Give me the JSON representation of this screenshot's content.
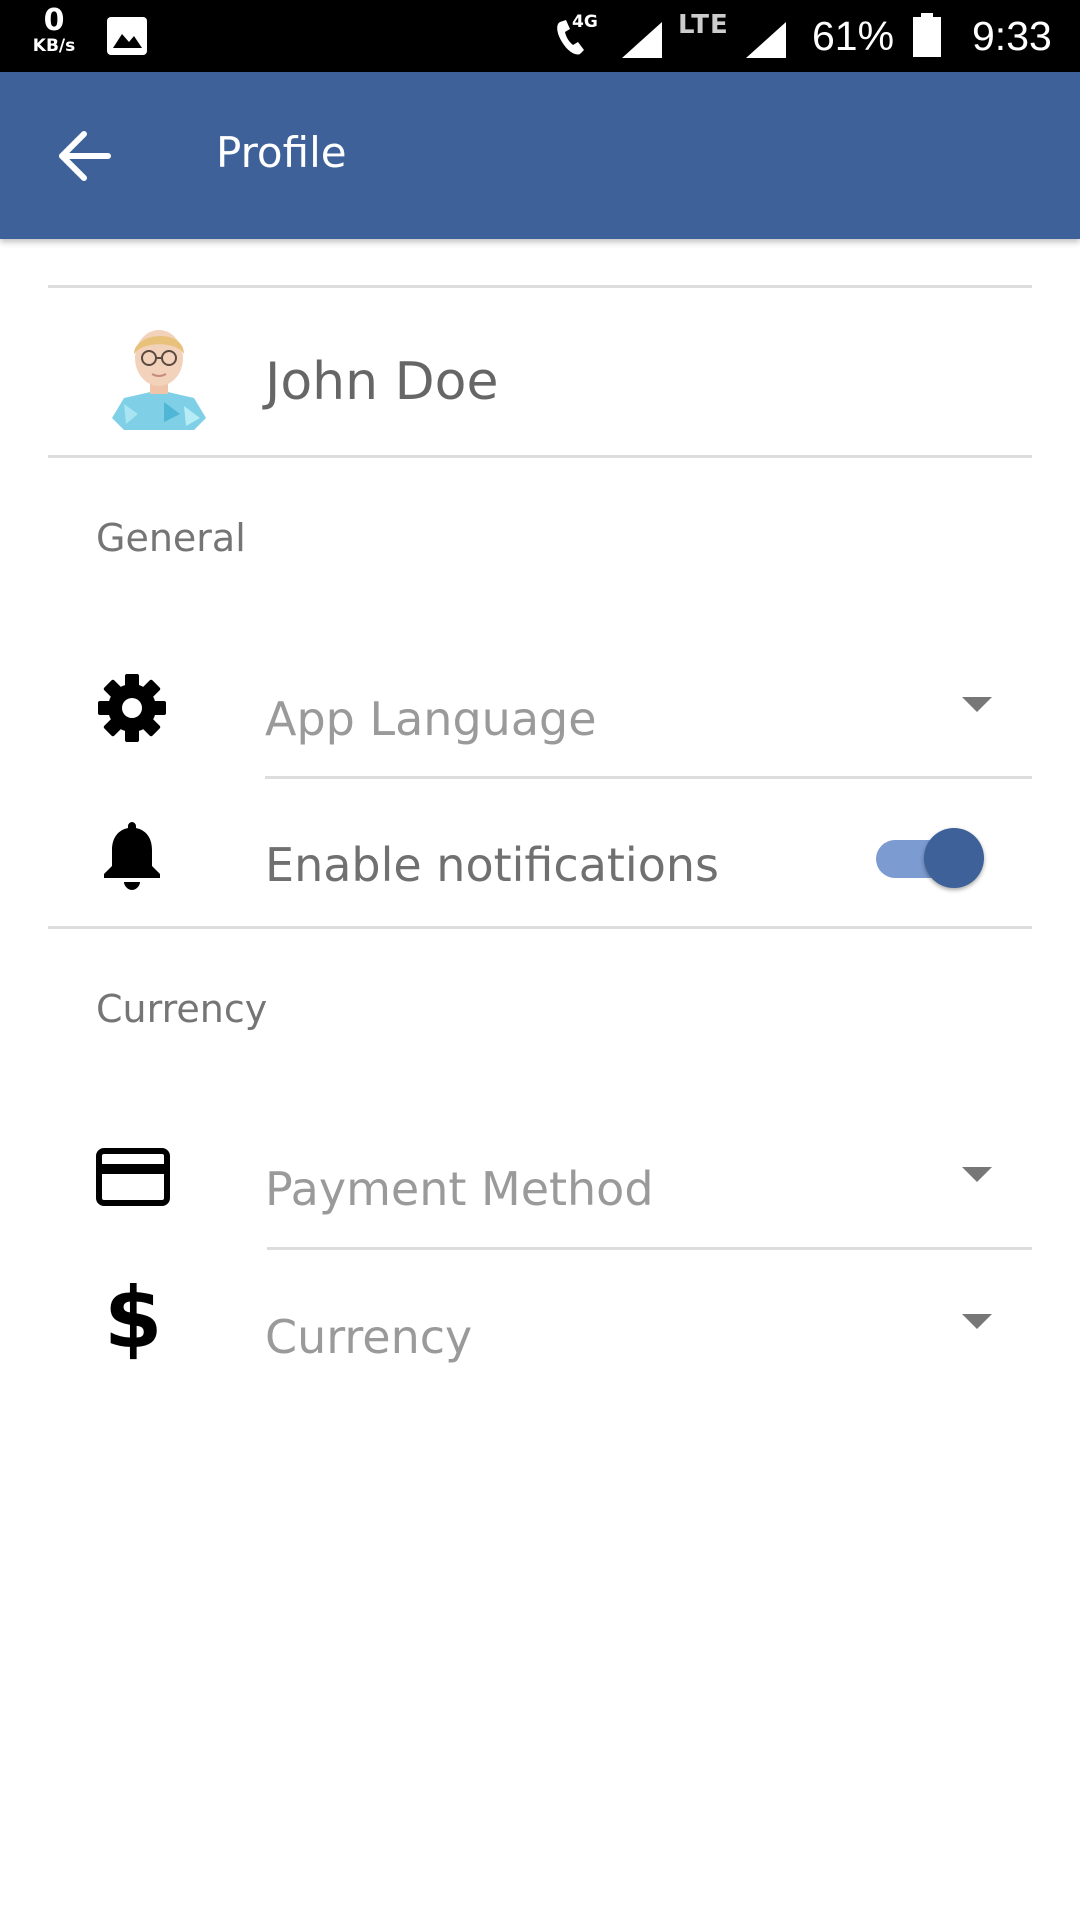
{
  "status_bar": {
    "data_speed": "0",
    "data_unit": "KB/s",
    "network_label": "4G",
    "lte_label": "LTE",
    "battery": "61%",
    "time": "9:33"
  },
  "app_bar": {
    "title": "Profile",
    "back_icon": "arrow-back-icon",
    "background_color": "#3d6198"
  },
  "profile": {
    "name": "John Doe"
  },
  "general": {
    "section_label": "General",
    "app_language": {
      "placeholder": "App Language",
      "icon": "gear-icon"
    },
    "notifications": {
      "label": "Enable notifications",
      "icon": "bell-icon",
      "enabled": true
    }
  },
  "currency_section": {
    "section_label": "Currency",
    "payment_method": {
      "placeholder": "Payment Method",
      "icon": "credit-card-icon"
    },
    "currency": {
      "placeholder": "Currency",
      "icon": "dollar-icon"
    }
  },
  "colors": {
    "accent": "#3d6198",
    "toggle_track": "#7c9bd1"
  }
}
